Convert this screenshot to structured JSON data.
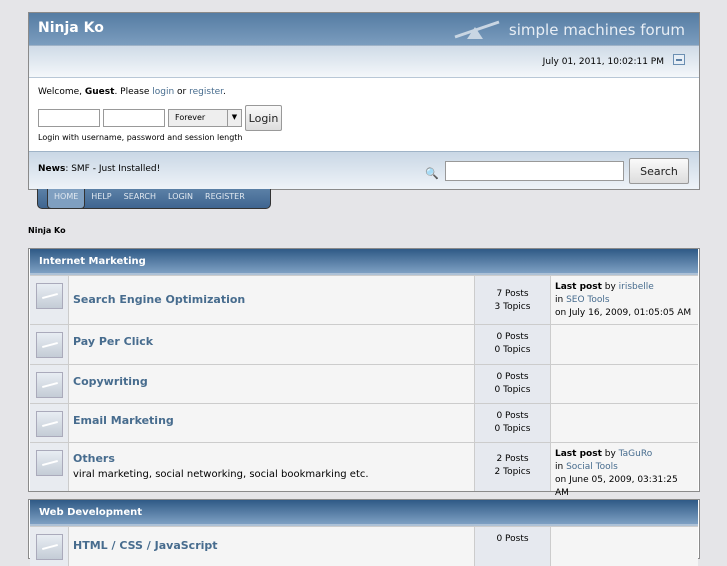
{
  "header": {
    "title": "Ninja Ko",
    "brand": "simple machines forum"
  },
  "date": "July 01, 2011, 10:02:11 PM",
  "login": {
    "welcome": "Welcome, ",
    "guest": "Guest",
    "please": ". Please ",
    "login_link": "login",
    "or": " or ",
    "register_link": "register",
    "period": ".",
    "session": "Forever",
    "button": "Login",
    "hint": "Login with username, password and session length"
  },
  "news": {
    "label": "News",
    "text": ": SMF - Just Installed!",
    "search_button": "Search"
  },
  "menu": [
    "HOME",
    "HELP",
    "SEARCH",
    "LOGIN",
    "REGISTER"
  ],
  "breadcrumb": "Ninja Ko",
  "categories": [
    {
      "title": "Internet Marketing",
      "boards": [
        {
          "name": "Search Engine Optimization",
          "desc": "",
          "posts": "7 Posts",
          "topics": "3 Topics",
          "last": {
            "by": "irisbelle",
            "in": "SEO Tools",
            "on": "on July 16, 2009, 01:05:05 AM"
          }
        },
        {
          "name": "Pay Per Click",
          "desc": "",
          "posts": "0 Posts",
          "topics": "0 Topics"
        },
        {
          "name": "Copywriting",
          "desc": "",
          "posts": "0 Posts",
          "topics": "0 Topics"
        },
        {
          "name": "Email Marketing",
          "desc": "",
          "posts": "0 Posts",
          "topics": "0 Topics"
        },
        {
          "name": "Others",
          "desc": "viral marketing, social networking, social bookmarking etc.",
          "posts": "2 Posts",
          "topics": "2 Topics",
          "last": {
            "by": "TaGuRo",
            "in": "Social Tools",
            "on": "on June 05, 2009, 03:31:25 AM"
          }
        }
      ]
    },
    {
      "title": "Web Development",
      "boards": [
        {
          "name": "HTML / CSS / JavaScript",
          "posts": "0 Posts"
        }
      ]
    }
  ],
  "labels": {
    "last_post": "Last post",
    "by": " by ",
    "in": "in "
  }
}
